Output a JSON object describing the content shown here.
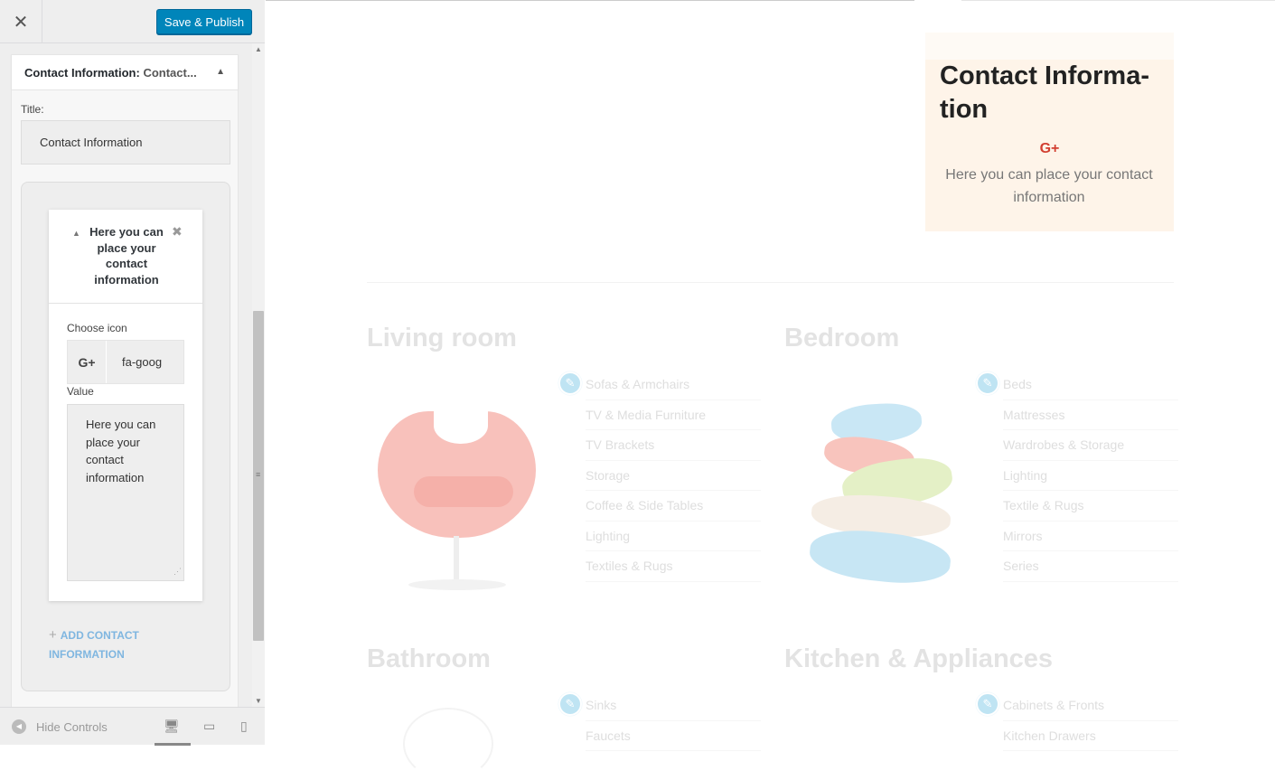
{
  "header": {
    "close_symbol": "✕",
    "save_label": "Save & Publish"
  },
  "widget": {
    "title_main": "Contact Information:",
    "title_sub": "Contact...",
    "title_label": "Title:",
    "title_value": "Contact Information"
  },
  "item": {
    "heading": "Here you can place your contact information",
    "choose_icon_label": "Choose icon",
    "icon_value": "fa-goog",
    "icon_glyph": "G+",
    "value_label": "Value",
    "value_text": "Here you can place your contact information"
  },
  "add_label": "ADD CONTACT INFORMATION",
  "footer": {
    "hide_controls": "Hide Controls"
  },
  "preview": {
    "contact_title": "Contact Informa-tion",
    "contact_glyph": "G+",
    "contact_text": "Here you can place your contact information",
    "categories": [
      {
        "title": "Living room",
        "items": [
          "Sofas & Armchairs",
          "TV & Media Furniture",
          "TV Brackets",
          "Storage",
          "Coffee & Side Tables",
          "Lighting",
          "Textiles & Rugs"
        ]
      },
      {
        "title": "Bedroom",
        "items": [
          "Beds",
          "Mattresses",
          "Wardrobes & Storage",
          "Lighting",
          "Textile & Rugs",
          "Mirrors",
          "Series"
        ]
      },
      {
        "title": "Bathroom",
        "items": [
          "Sinks",
          "Faucets"
        ]
      },
      {
        "title": "Kitchen & Appliances",
        "items": [
          "Cabinets & Fronts",
          "Kitchen Drawers"
        ]
      }
    ]
  },
  "colors": {
    "accent": "#0085ba",
    "gplus": "#d23f31",
    "contact_bg": "#fef4e9"
  }
}
